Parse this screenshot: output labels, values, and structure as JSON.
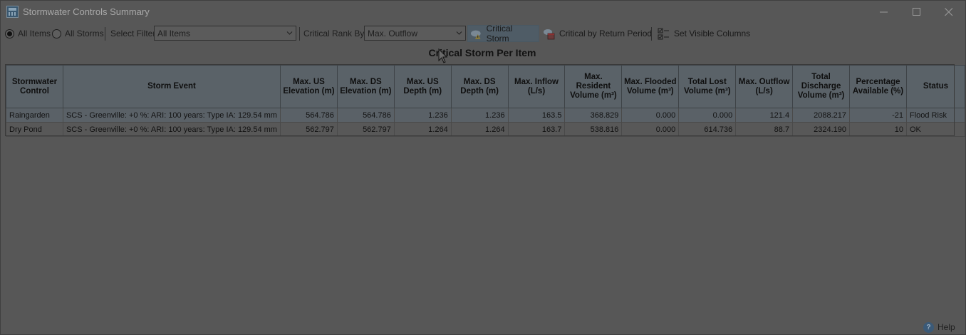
{
  "window": {
    "title": "Stormwater Controls Summary"
  },
  "toolbar": {
    "radio_all_items": "All Items",
    "radio_all_storms": "All Storms",
    "select_filter_label": "Select Filter",
    "select_filter_value": "All Items",
    "critical_rank_label": "Critical Rank By:",
    "critical_rank_value": "Max. Outflow",
    "critical_storm_label": "Critical Storm",
    "critical_return_label": "Critical by Return Period",
    "visible_columns_label": "Set Visible Columns"
  },
  "grid": {
    "title": "Critical Storm Per Item",
    "columns": [
      "Stormwater Control",
      "Storm Event",
      "Max. US Elevation (m)",
      "Max. DS Elevation (m)",
      "Max. US Depth (m)",
      "Max. DS Depth (m)",
      "Max. Inflow (L/s)",
      "Max. Resident Volume (m³)",
      "Max. Flooded Volume (m³)",
      "Total Lost Volume (m³)",
      "Max. Outflow (L/s)",
      "Total Discharge Volume (m³)",
      "Percentage Available (%)",
      "Status"
    ],
    "rows": [
      [
        "Raingarden",
        "SCS - Greenville: +0 %: ARI: 100 years: Type IA: 129.54 mm",
        "564.786",
        "564.786",
        "1.236",
        "1.236",
        "163.5",
        "368.829",
        "0.000",
        "0.000",
        "121.4",
        "2088.217",
        "-21",
        "Flood Risk"
      ],
      [
        "Dry Pond",
        "SCS - Greenville: +0 %: ARI: 100 years: Type IA: 129.54 mm",
        "562.797",
        "562.797",
        "1.264",
        "1.264",
        "163.7",
        "538.816",
        "0.000",
        "614.736",
        "88.7",
        "2324.190",
        "10",
        "OK"
      ]
    ]
  },
  "footer": {
    "help_label": "Help"
  },
  "colors": {
    "overlay_background": "#575757",
    "header_background": "#5a6268",
    "selected_row": "#5a6167",
    "active_button": "#4f5c66"
  },
  "icons": {
    "app": "app-grid-icon",
    "critical_storm": "cloud-warning-icon",
    "critical_return": "calendar-cloud-icon",
    "visible_columns": "checklist-icon",
    "help": "help-question-icon"
  }
}
